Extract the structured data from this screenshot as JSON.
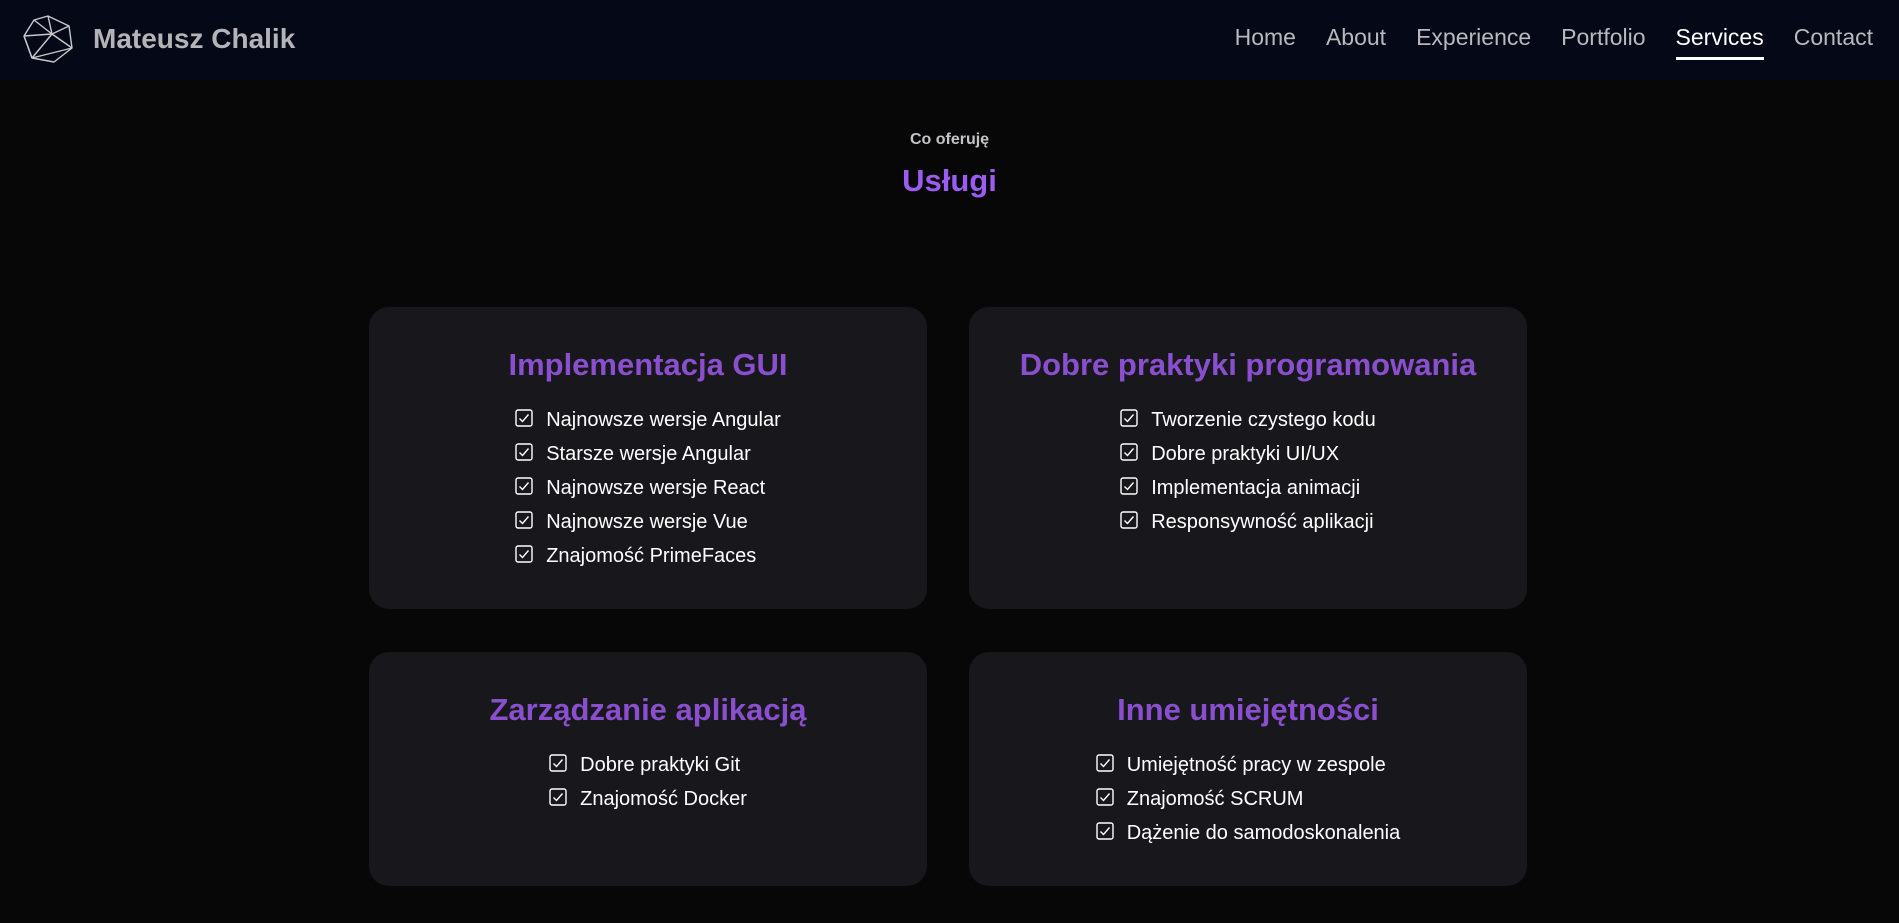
{
  "nav": {
    "brand": "Mateusz Chalik",
    "links": [
      "Home",
      "About",
      "Experience",
      "Portfolio",
      "Services",
      "Contact"
    ],
    "active": "Services"
  },
  "section": {
    "subtitle": "Co oferuję",
    "title": "Usługi"
  },
  "cards": [
    {
      "title": "Implementacja GUI",
      "items": [
        "Najnowsze wersje Angular",
        "Starsze wersje Angular",
        "Najnowsze wersje React",
        "Najnowsze wersje Vue",
        "Znajomość PrimeFaces"
      ]
    },
    {
      "title": "Dobre praktyki programowania",
      "items": [
        "Tworzenie czystego kodu",
        "Dobre praktyki UI/UX",
        "Implementacja animacji",
        "Responsywność aplikacji"
      ]
    },
    {
      "title": "Zarządzanie aplikacją",
      "items": [
        "Dobre praktyki Git",
        "Znajomość Docker"
      ]
    },
    {
      "title": "Inne umiejętności",
      "items": [
        "Umiejętność pracy w zespole",
        "Znajomość SCRUM",
        "Dążenie do samodoskonalenia"
      ]
    }
  ],
  "icons": {
    "logo": "polyhedron-logo-icon",
    "check": "checkbox-checked-icon"
  },
  "colors": {
    "accent": "#9c5cf3",
    "card_title": "#8a4fce",
    "card_bg": "#18181c",
    "nav_bg": "#050816",
    "page_bg": "#070707"
  }
}
